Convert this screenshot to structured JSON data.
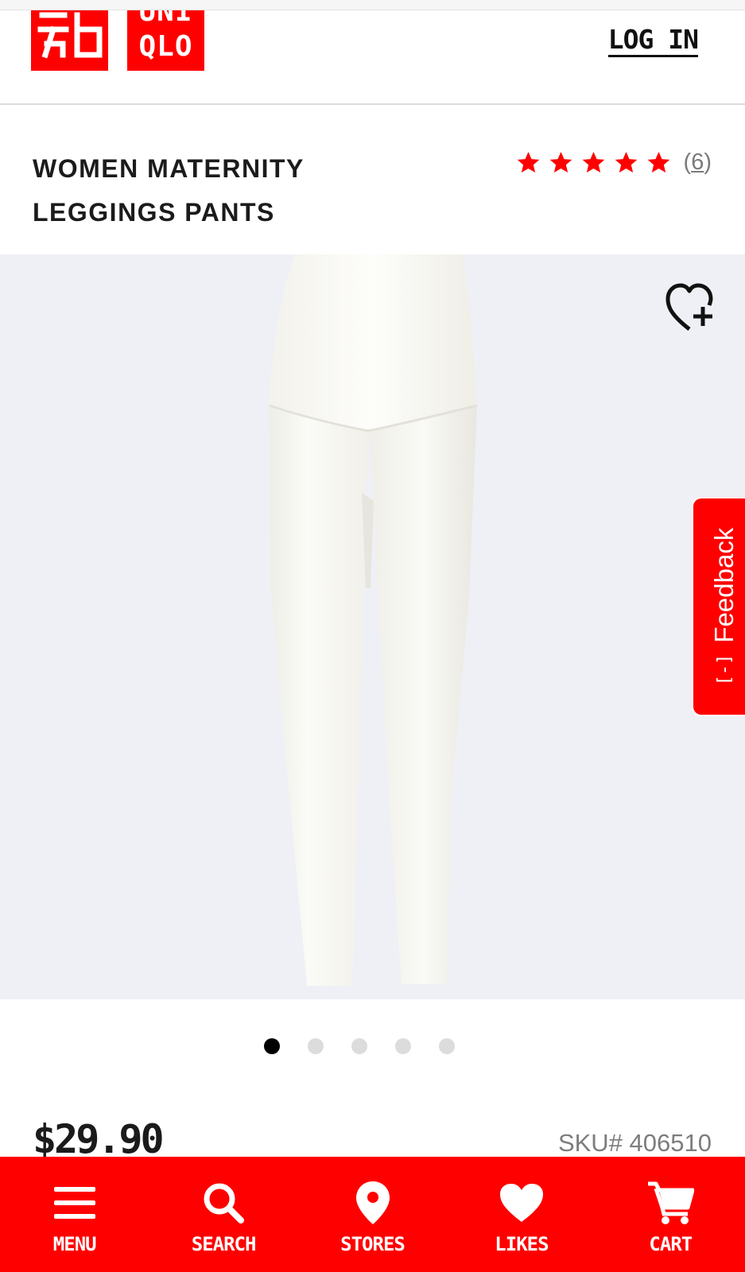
{
  "brand": {
    "logo_latin_line1": "UNI",
    "logo_latin_line2": "QLO",
    "color": "#ff0000"
  },
  "header": {
    "login_label": "LOG IN"
  },
  "product": {
    "title_line1": "WOMEN MATERNITY",
    "title_line2": "LEGGINGS PANTS",
    "rating": {
      "stars": 5,
      "review_count": "6",
      "paren_open": "(",
      "paren_close": ")",
      "star_color": "#ff0000"
    },
    "price": "$29.90",
    "sku": "SKU# 406510",
    "image": {
      "background": "#eff0f5",
      "pager": {
        "total": 5,
        "active": 1
      }
    },
    "wishlist_icon": "heart-plus-icon"
  },
  "feedback": {
    "label": "Feedback",
    "icon": "[-]"
  },
  "bottom_nav": [
    {
      "label": "MENU",
      "icon": "hamburger-icon"
    },
    {
      "label": "SEARCH",
      "icon": "search-icon"
    },
    {
      "label": "STORES",
      "icon": "map-pin-icon"
    },
    {
      "label": "LIKES",
      "icon": "heart-icon"
    },
    {
      "label": "CART",
      "icon": "cart-icon"
    }
  ]
}
